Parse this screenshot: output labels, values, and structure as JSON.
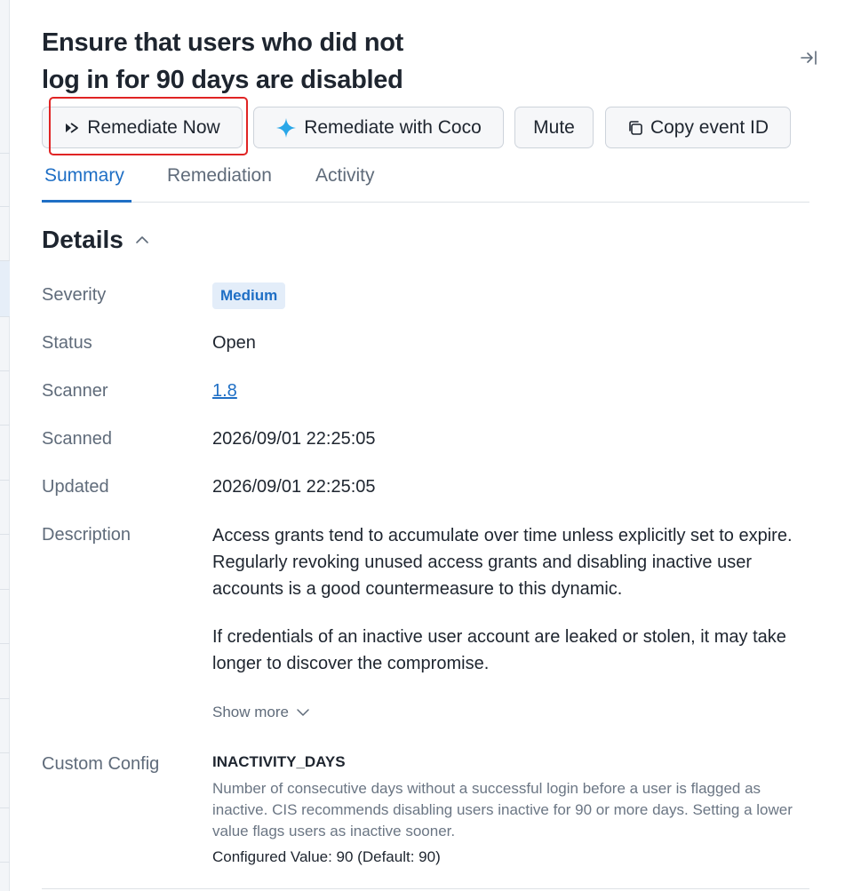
{
  "panel": {
    "title": "Ensure that users who did not log in for 90 days are disabled"
  },
  "actions": {
    "remediate_now": "Remediate Now",
    "remediate_coco": "Remediate with Coco",
    "mute": "Mute",
    "copy_event": "Copy event ID"
  },
  "tabs": [
    {
      "label": "Summary",
      "active": true
    },
    {
      "label": "Remediation",
      "active": false
    },
    {
      "label": "Activity",
      "active": false
    }
  ],
  "details": {
    "title": "Details",
    "severity_label": "Severity",
    "severity": "Medium",
    "status_label": "Status",
    "status": "Open",
    "scanner_label": "Scanner",
    "scanner": "1.8",
    "scanned_label": "Scanned",
    "scanned": "2026/09/01 22:25:05",
    "updated_label": "Updated",
    "updated": "2026/09/01 22:25:05",
    "description_label": "Description",
    "description_p1": "Access grants tend to accumulate over time unless explicitly set to expire. Regularly revoking unused access grants and disabling inactive user accounts is a good countermeasure to this dynamic.",
    "description_p2": "If credentials of an inactive user account are leaked or stolen, it may take longer to discover the compromise.",
    "show_more": "Show more",
    "custom_config_label": "Custom Config",
    "config_key": "INACTIVITY_DAYS",
    "config_help": "Number of consecutive days without a successful login before a user is flagged as inactive. CIS recommends disabling users inactive for 90 or more days. Setting a lower value flags users as inactive sooner.",
    "config_value": "Configured Value: 90 (Default: 90)"
  },
  "colors": {
    "accent": "#1f6fc5",
    "badge_bg": "#e3edf9",
    "focus_ring": "#e02424",
    "coco_icon": "#2aa7e8"
  }
}
